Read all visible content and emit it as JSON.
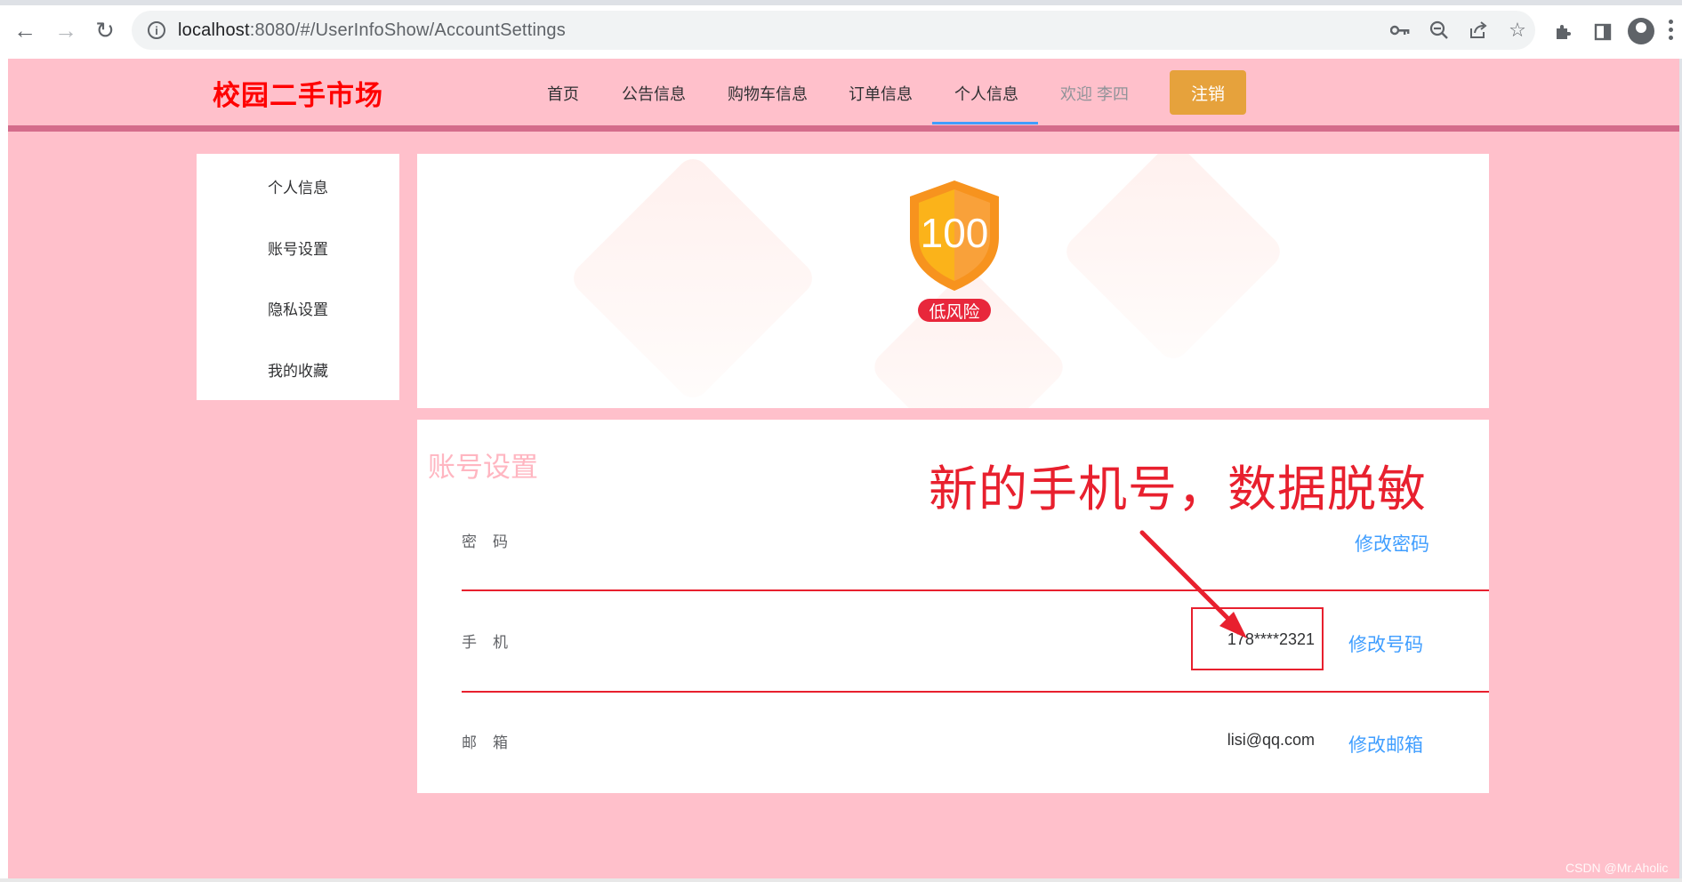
{
  "browser": {
    "url_host": "localhost",
    "url_rest": ":8080/#/UserInfoShow/AccountSettings"
  },
  "header": {
    "logo": "校园二手市场",
    "menu": [
      {
        "label": "首页"
      },
      {
        "label": "公告信息"
      },
      {
        "label": "购物车信息"
      },
      {
        "label": "订单信息"
      },
      {
        "label": "个人信息",
        "active": true
      }
    ],
    "welcome": "欢迎 李四",
    "logout_label": "注销"
  },
  "sidebar": {
    "items": [
      {
        "label": "个人信息"
      },
      {
        "label": "账号设置"
      },
      {
        "label": "隐私设置"
      },
      {
        "label": "我的收藏"
      }
    ]
  },
  "security": {
    "score": "100",
    "risk_label": "低风险"
  },
  "account": {
    "title": "账号设置",
    "annotation": "新的手机号，数据脱敏",
    "rows": [
      {
        "label": "密码",
        "value": "",
        "action": "修改密码"
      },
      {
        "label": "手机",
        "value": "178****2321",
        "action": "修改号码"
      },
      {
        "label": "邮箱",
        "value": "lisi@qq.com",
        "action": "修改邮箱"
      }
    ]
  },
  "watermark": "CSDN @Mr.Aholic",
  "colors": {
    "page_bg": "#ffc0cb",
    "header_bar": "#d46c8b",
    "logo": "#ff0000",
    "logout_button": "#e6a23c",
    "link": "#409eff",
    "annotation_red": "#e8202e"
  }
}
